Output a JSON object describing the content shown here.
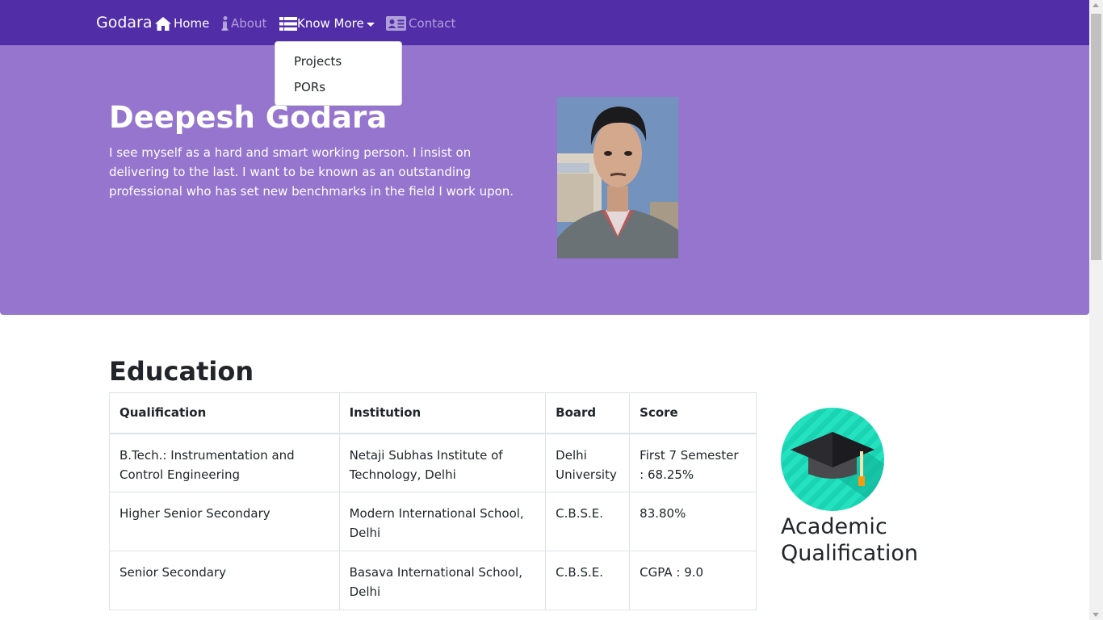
{
  "navbar": {
    "brand": "Godara",
    "items": [
      {
        "label": "Home",
        "icon": "home-icon"
      },
      {
        "label": "About",
        "icon": "info-icon"
      },
      {
        "label": "Know More",
        "icon": "list-icon"
      },
      {
        "label": "Contact",
        "icon": "address-card-icon"
      }
    ],
    "dropdown": [
      "Projects",
      "PORs"
    ]
  },
  "hero": {
    "name": "Deepesh Godara",
    "bio": "I see myself as a hard and smart working person. I insist on delivering to the last. I want to be known as an outstanding professional who has set new benchmarks in the field I work upon."
  },
  "education": {
    "title": "Education",
    "headers": [
      "Qualification",
      "Institution",
      "Board",
      "Score"
    ],
    "rows": [
      [
        "B.Tech.: Instrumentation and Control Engineering",
        "Netaji Subhas Institute of Technology, Delhi",
        "Delhi University",
        "First 7 Semester : 68.25%"
      ],
      [
        "Higher Senior Secondary",
        "Modern International School, Delhi",
        "C.B.S.E.",
        "83.80%"
      ],
      [
        "Senior Secondary",
        "Basava International School, Delhi",
        "C.B.S.E.",
        "CGPA : 9.0"
      ]
    ],
    "side_label_line1": "Academic",
    "side_label_line2": "Qualification"
  },
  "colors": {
    "navbar": "#512da8",
    "hero": "#9575cd",
    "accent": "#1de9b6"
  }
}
